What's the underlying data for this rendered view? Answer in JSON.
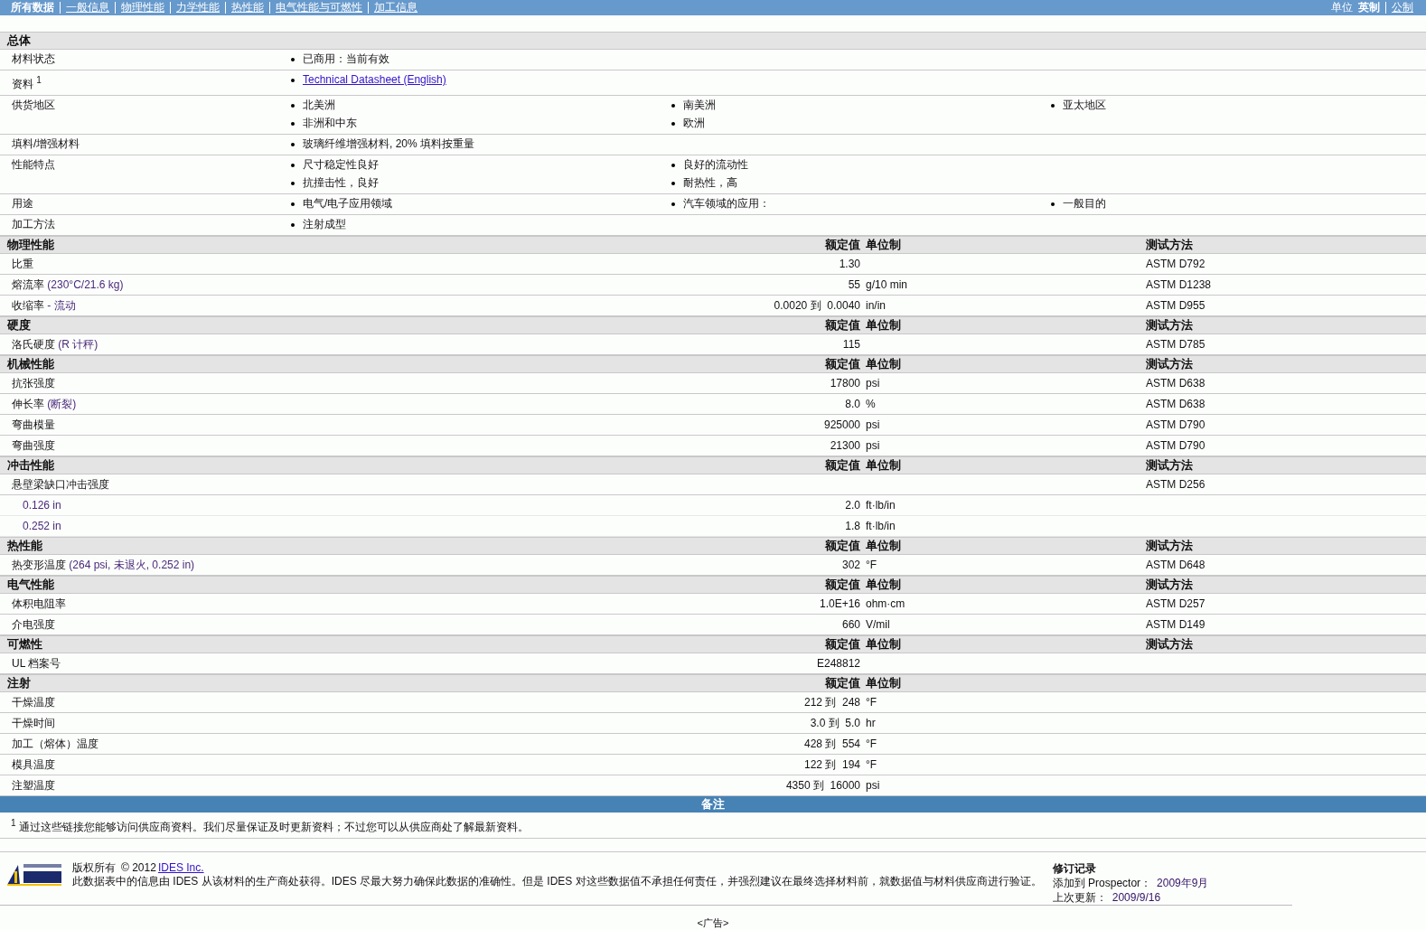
{
  "nav": {
    "items": [
      {
        "label": "所有数据",
        "selected": true
      },
      {
        "label": "一般信息",
        "selected": false
      },
      {
        "label": "物理性能",
        "selected": false
      },
      {
        "label": "力学性能",
        "selected": false
      },
      {
        "label": "热性能",
        "selected": false
      },
      {
        "label": "电气性能与可燃性",
        "selected": false
      },
      {
        "label": "加工信息",
        "selected": false
      }
    ],
    "units_label": "单位",
    "units": [
      {
        "label": "英制",
        "selected": true
      },
      {
        "label": "公制",
        "selected": false
      }
    ]
  },
  "general": {
    "title": "总体",
    "rows": [
      {
        "label": "材料状态",
        "columns": [
          [
            {
              "text": "已商用：当前有效",
              "kind": "text"
            }
          ]
        ]
      },
      {
        "label": "资料 $^{1}$",
        "columns": [
          [
            {
              "text": "Technical Datasheet (English)",
              "kind": "link"
            }
          ]
        ]
      },
      {
        "label": "供货地区",
        "columns": [
          [
            {
              "text": "北美洲",
              "kind": "text"
            },
            {
              "text": "非洲和中东",
              "kind": "text"
            }
          ],
          [
            {
              "text": "南美洲",
              "kind": "text"
            },
            {
              "text": "欧洲",
              "kind": "text"
            }
          ],
          [
            {
              "text": "亚太地区",
              "kind": "text"
            }
          ]
        ]
      },
      {
        "label": "填料/增强材料",
        "columns": [
          [
            {
              "text": "玻璃纤维增强材料, 20% 填料按重量",
              "kind": "text"
            }
          ]
        ]
      },
      {
        "label": "性能特点",
        "columns": [
          [
            {
              "text": "尺寸稳定性良好",
              "kind": "text"
            },
            {
              "text": "抗撞击性，良好",
              "kind": "text"
            }
          ],
          [
            {
              "text": "良好的流动性",
              "kind": "text"
            },
            {
              "text": "耐热性，高",
              "kind": "text"
            }
          ]
        ]
      },
      {
        "label": "用途",
        "columns": [
          [
            {
              "text": "电气/电子应用领域",
              "kind": "text"
            }
          ],
          [
            {
              "text": "汽车领域的应用：",
              "kind": "text"
            }
          ],
          [
            {
              "text": "一般目的",
              "kind": "text"
            }
          ]
        ]
      },
      {
        "label": "加工方法",
        "columns": [
          [
            {
              "text": "注射成型",
              "kind": "text"
            }
          ]
        ]
      }
    ]
  },
  "sections": [
    {
      "title": "物理性能",
      "value_header": "额定值",
      "unit_header": "单位制",
      "method_header": "测试方法",
      "rows": [
        {
          "kind": "main",
          "label": "比重",
          "value": "1.30",
          "method": "ASTM D792"
        },
        {
          "kind": "main",
          "label": "熔流率",
          "note": "(230°C/21.6 kg)",
          "value": "55",
          "unit": "g/10 min",
          "method": "ASTM D1238"
        },
        {
          "kind": "main",
          "label": "收缩率",
          "note": "- 流动",
          "value": "0.0020 到  0.0040",
          "unit": "in/in",
          "method": "ASTM D955"
        }
      ]
    },
    {
      "title": "硬度",
      "value_header": "额定值",
      "unit_header": "单位制",
      "method_header": "测试方法",
      "rows": [
        {
          "kind": "main",
          "label": "洛氏硬度",
          "note": "(R 计秤)",
          "value": "115",
          "method": "ASTM D785"
        }
      ]
    },
    {
      "title": "机械性能",
      "value_header": "额定值",
      "unit_header": "单位制",
      "method_header": "测试方法",
      "rows": [
        {
          "kind": "main",
          "label": "抗张强度",
          "value": "17800",
          "unit": "psi",
          "method": "ASTM D638"
        },
        {
          "kind": "main",
          "label": "伸长率",
          "note": "(断裂)",
          "value": "8.0",
          "unit": "%",
          "method": "ASTM D638"
        },
        {
          "kind": "main",
          "label": "弯曲模量",
          "value": "925000",
          "unit": "psi",
          "method": "ASTM D790"
        },
        {
          "kind": "main",
          "label": "弯曲强度",
          "value": "21300",
          "unit": "psi",
          "method": "ASTM D790"
        }
      ]
    },
    {
      "title": "冲击性能",
      "value_header": "额定值",
      "unit_header": "单位制",
      "method_header": "测试方法",
      "rows": [
        {
          "kind": "main",
          "label": "悬壁梁缺口冲击强度",
          "method": "ASTM D256"
        },
        {
          "kind": "sub",
          "label": "0.126 in",
          "value": "2.0",
          "unit": "ft·lb/in"
        },
        {
          "kind": "sub",
          "label": "0.252 in",
          "value": "1.8",
          "unit": "ft·lb/in"
        }
      ]
    },
    {
      "title": "热性能",
      "value_header": "额定值",
      "unit_header": "单位制",
      "method_header": "测试方法",
      "rows": [
        {
          "kind": "main",
          "label": "热变形温度",
          "note": "(264 psi, 未退火, 0.252 in)",
          "value": "302",
          "unit": "°F",
          "method": "ASTM D648"
        }
      ]
    },
    {
      "title": "电气性能",
      "value_header": "额定值",
      "unit_header": "单位制",
      "method_header": "测试方法",
      "rows": [
        {
          "kind": "main",
          "label": "体积电阻率",
          "value": "1.0E+16",
          "unit": "ohm·cm",
          "method": "ASTM D257"
        },
        {
          "kind": "main",
          "label": "介电强度",
          "value": "660",
          "unit": "V/mil",
          "method": "ASTM D149"
        }
      ]
    },
    {
      "title": "可燃性",
      "value_header": "额定值",
      "unit_header": "单位制",
      "method_header": "测试方法",
      "rows": [
        {
          "kind": "main",
          "label": "UL 档案号",
          "value": "E248812"
        }
      ]
    },
    {
      "title": "注射",
      "value_header": "额定值",
      "unit_header": "单位制",
      "rows": [
        {
          "kind": "main",
          "label": "干燥温度",
          "value": "212 到  248",
          "unit": "°F"
        },
        {
          "kind": "main",
          "label": "干燥时间",
          "value": "3.0 到  5.0",
          "unit": "hr"
        },
        {
          "kind": "main",
          "label": "加工（熔体）温度",
          "value": "428 到  554",
          "unit": "°F"
        },
        {
          "kind": "main",
          "label": "模具温度",
          "value": "122 到  194",
          "unit": "°F"
        },
        {
          "kind": "main",
          "label": "注塑温度",
          "value": "4350 到  16000",
          "unit": "psi"
        }
      ]
    }
  ],
  "notes": {
    "title": "备注",
    "footnote": "$^{1}$ 通过这些链接您能够访问供应商资料。我们尽量保证及时更新资料；不过您可以从供应商处了解最新资料。"
  },
  "footer": {
    "copyright": "版权所有",
    "year": "© 2012",
    "company_link": "IDES Inc.",
    "disclaimer": "此数据表中的信息由  IDES 从该材料的生产商处获得。IDES 尽最大努力确保此数据的准确性。但是  IDES 对这些数据值不承担任何责任，并强烈建议在最终选择材料前，就数据值与材料供应商进行验证。",
    "revision": {
      "title": "修订记录",
      "added_label": "添加到 Prospector：",
      "added_value": "2009年9月",
      "updated_label": "上次更新：",
      "updated_value": "2009/9/16"
    }
  },
  "ad_label": "<广告>"
}
